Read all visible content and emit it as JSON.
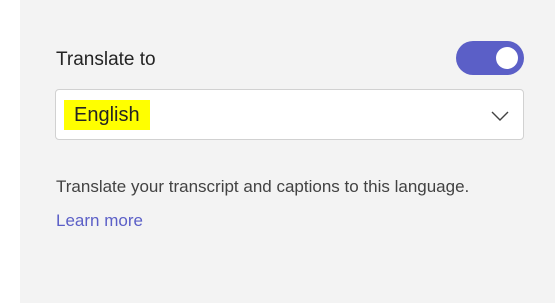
{
  "section": {
    "label": "Translate to",
    "toggle": {
      "state": "on",
      "accent": "#5b5fc7"
    }
  },
  "language_select": {
    "selected": "English",
    "highlight_color": "#ffff00"
  },
  "description": {
    "text": "Translate your transcript and captions to this language.",
    "link": "Learn more"
  }
}
